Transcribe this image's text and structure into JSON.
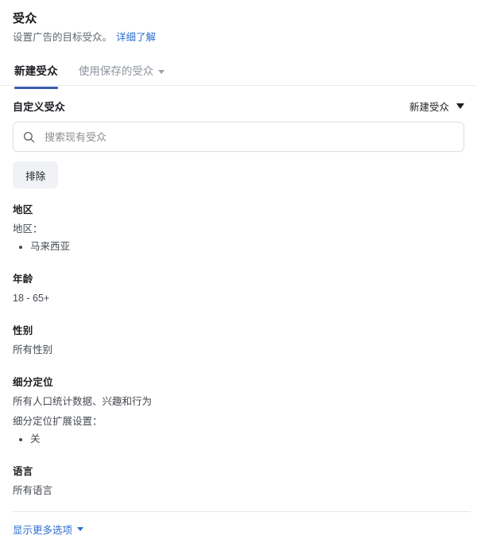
{
  "header": {
    "title": "受众",
    "subtitle": "设置广告的目标受众。",
    "learn_more": "详细了解"
  },
  "tabs": [
    {
      "label": "新建受众",
      "active": true,
      "has_caret": false
    },
    {
      "label": "使用保存的受众",
      "active": false,
      "has_caret": true
    }
  ],
  "custom_audience": {
    "label": "自定义受众",
    "create_dropdown_label": "新建受众",
    "search_placeholder": "搜索现有受众",
    "search_value": "",
    "search_icon": "search-icon",
    "exclude_button": "排除"
  },
  "sections": [
    {
      "key": "location",
      "title": "地区",
      "sub_label": "地区：",
      "bullets": [
        "马来西亚"
      ],
      "value": ""
    },
    {
      "key": "age",
      "title": "年龄",
      "value": "18 - 65+",
      "bullets": []
    },
    {
      "key": "gender",
      "title": "性别",
      "value": "所有性别",
      "bullets": []
    },
    {
      "key": "detailed_targeting",
      "title": "细分定位",
      "value": "所有人口统计数据、兴趣和行为",
      "sub_label": "细分定位扩展设置：",
      "bullets": [
        "关"
      ]
    },
    {
      "key": "language",
      "title": "语言",
      "value": "所有语言",
      "bullets": []
    }
  ],
  "footer": {
    "show_more_label": "显示更多选项",
    "caret_icon": "chevron-down-icon"
  },
  "colors": {
    "link_blue": "#2d6ed2",
    "tab_underline": "#3b5ca8",
    "button_bg": "#f0f2f5",
    "border": "#dddfe2",
    "text_primary": "#1c1e21",
    "text_secondary": "#606770"
  }
}
